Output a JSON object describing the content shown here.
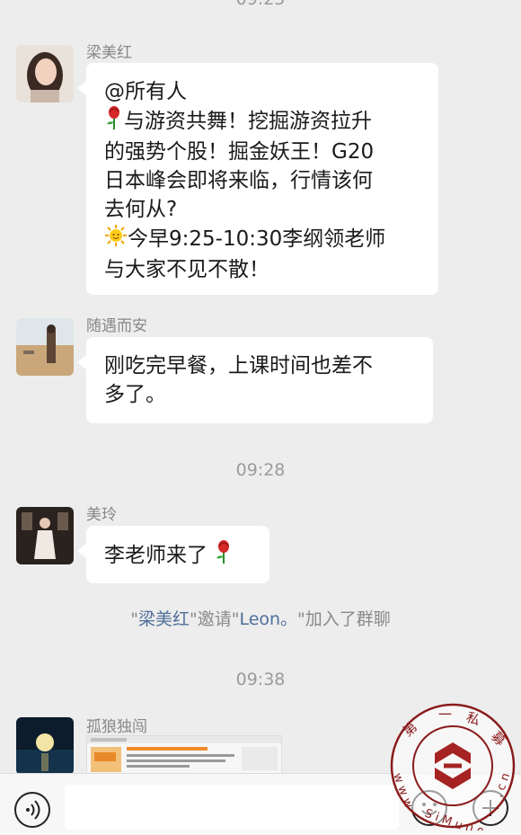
{
  "chat": {
    "top_timestamp": "09:25",
    "messages": [
      {
        "sender": "梁美红",
        "avatar_icon": "woman-portrait-avatar",
        "lines": [
          "@所有人",
          "与游资共舞！挖掘游资拉升",
          "的强势个股！掘金妖王！G20",
          "日本峰会即将来临，行情该何",
          "去何从?",
          "今早9:25-10:30李纲领老师",
          "与大家不见不散！"
        ],
        "emoji_1": "rose-emoji",
        "emoji_2": "sun-emoji"
      },
      {
        "sender": "随遇而安",
        "avatar_icon": "beach-photo-avatar",
        "lines": [
          "刚吃完早餐，上课时间也差不",
          "多了。"
        ]
      },
      {
        "sender": "美玲",
        "avatar_icon": "woman-dress-avatar",
        "lines": [
          "李老师来了"
        ],
        "emoji_1": "rose-emoji"
      },
      {
        "sender": "孤狼独闯",
        "avatar_icon": "moon-night-avatar",
        "attachment": "image-preview"
      }
    ],
    "timestamp_2": "09:28",
    "timestamp_3": "09:38",
    "system": {
      "q1": "\"",
      "inviter": "梁美红",
      "mid": "\"邀请\"",
      "invitee": "Leon。",
      "end": "\"加入了群聊"
    }
  },
  "input_bar": {
    "voice_icon": "voice-icon",
    "emoji_icon": "emoji-face-icon",
    "plus_icon": "plus-icon",
    "placeholder": ""
  },
  "watermark": {
    "text": "第一私募 www.simuwang.cn"
  }
}
